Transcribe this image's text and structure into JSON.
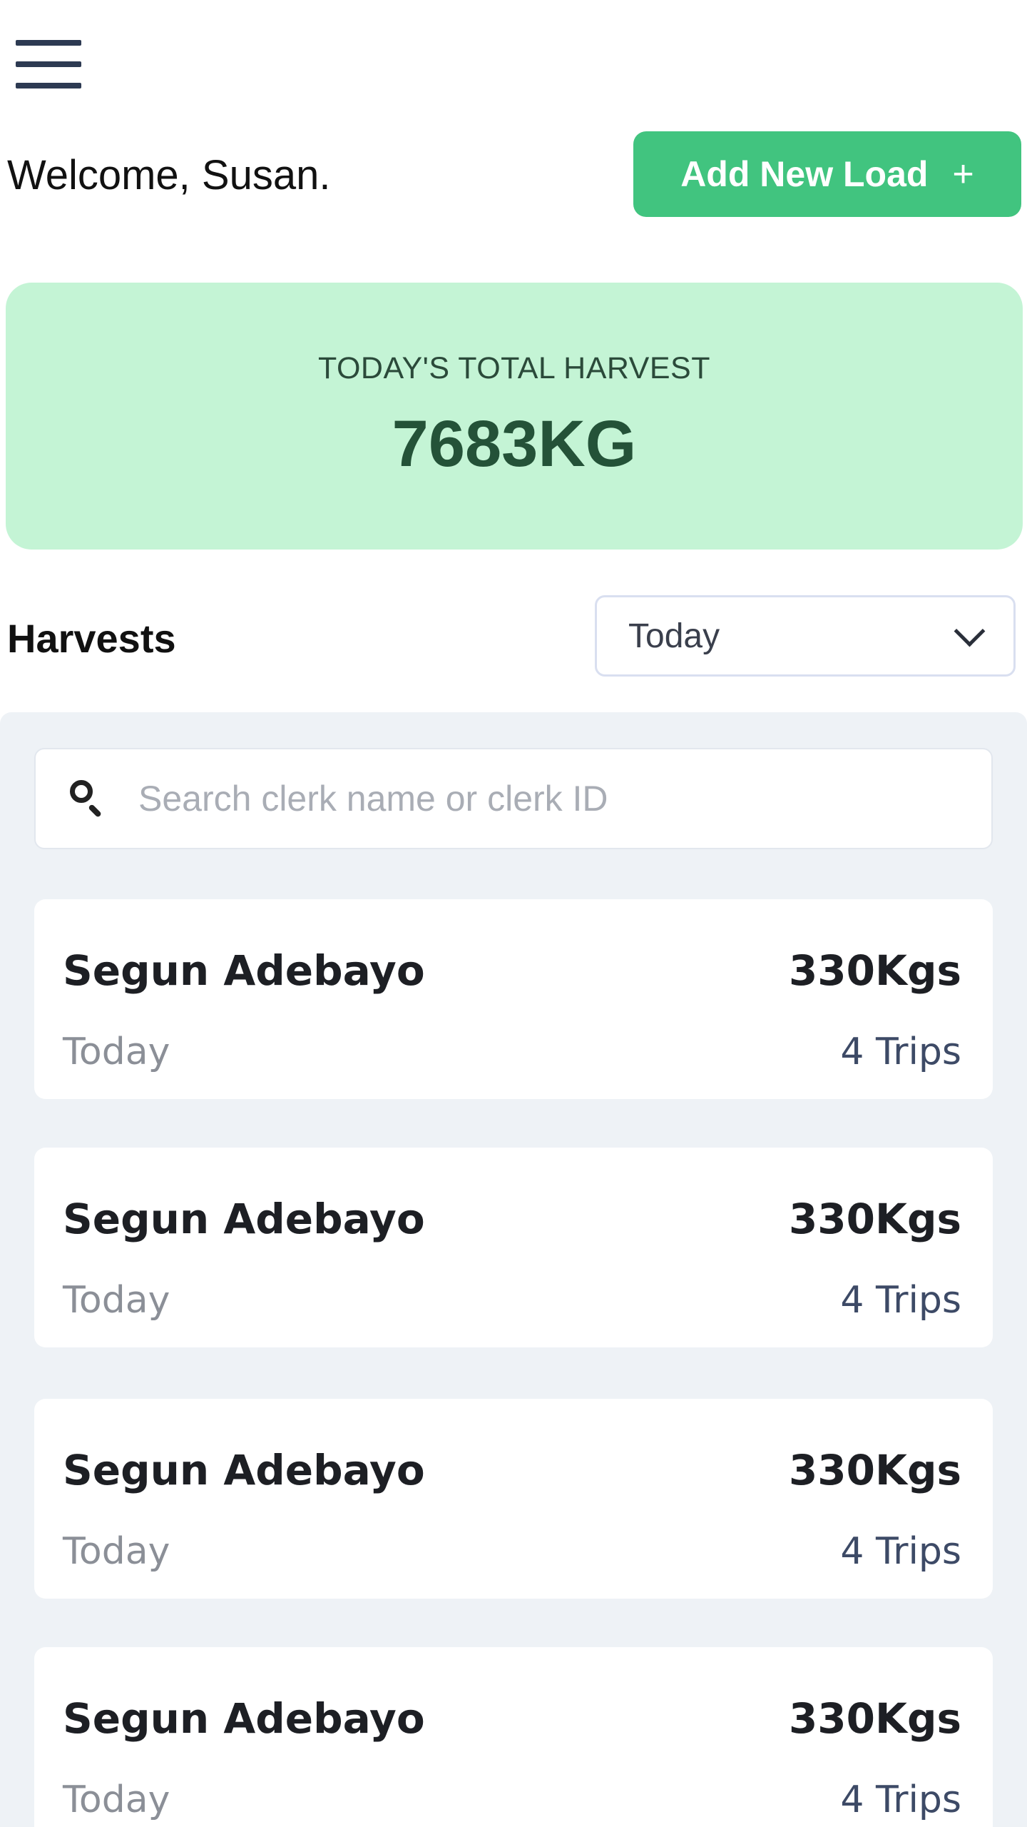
{
  "header": {
    "menu_icon": "hamburger-menu-icon",
    "welcome_text": "Welcome, Susan.",
    "add_button_label": "Add New Load",
    "add_button_icon": "+"
  },
  "summary": {
    "label": "TODAY'S TOTAL HARVEST",
    "value": "7683KG"
  },
  "harvests": {
    "title": "Harvests",
    "filter_selected": "Today",
    "search_placeholder": "Search clerk name or clerk ID",
    "items": [
      {
        "name": "Segun Adebayo",
        "weight": "330Kgs",
        "date": "Today",
        "trips": "4 Trips"
      },
      {
        "name": "Segun Adebayo",
        "weight": "330Kgs",
        "date": "Today",
        "trips": "4 Trips"
      },
      {
        "name": "Segun Adebayo",
        "weight": "330Kgs",
        "date": "Today",
        "trips": "4 Trips"
      },
      {
        "name": "Segun Adebayo",
        "weight": "330Kgs",
        "date": "Today",
        "trips": "4 Trips"
      }
    ]
  },
  "colors": {
    "accent_green": "#41c47f",
    "summary_bg": "#c4f4d5",
    "panel_bg": "#eef2f6",
    "icon_dark": "#2d3a52"
  }
}
